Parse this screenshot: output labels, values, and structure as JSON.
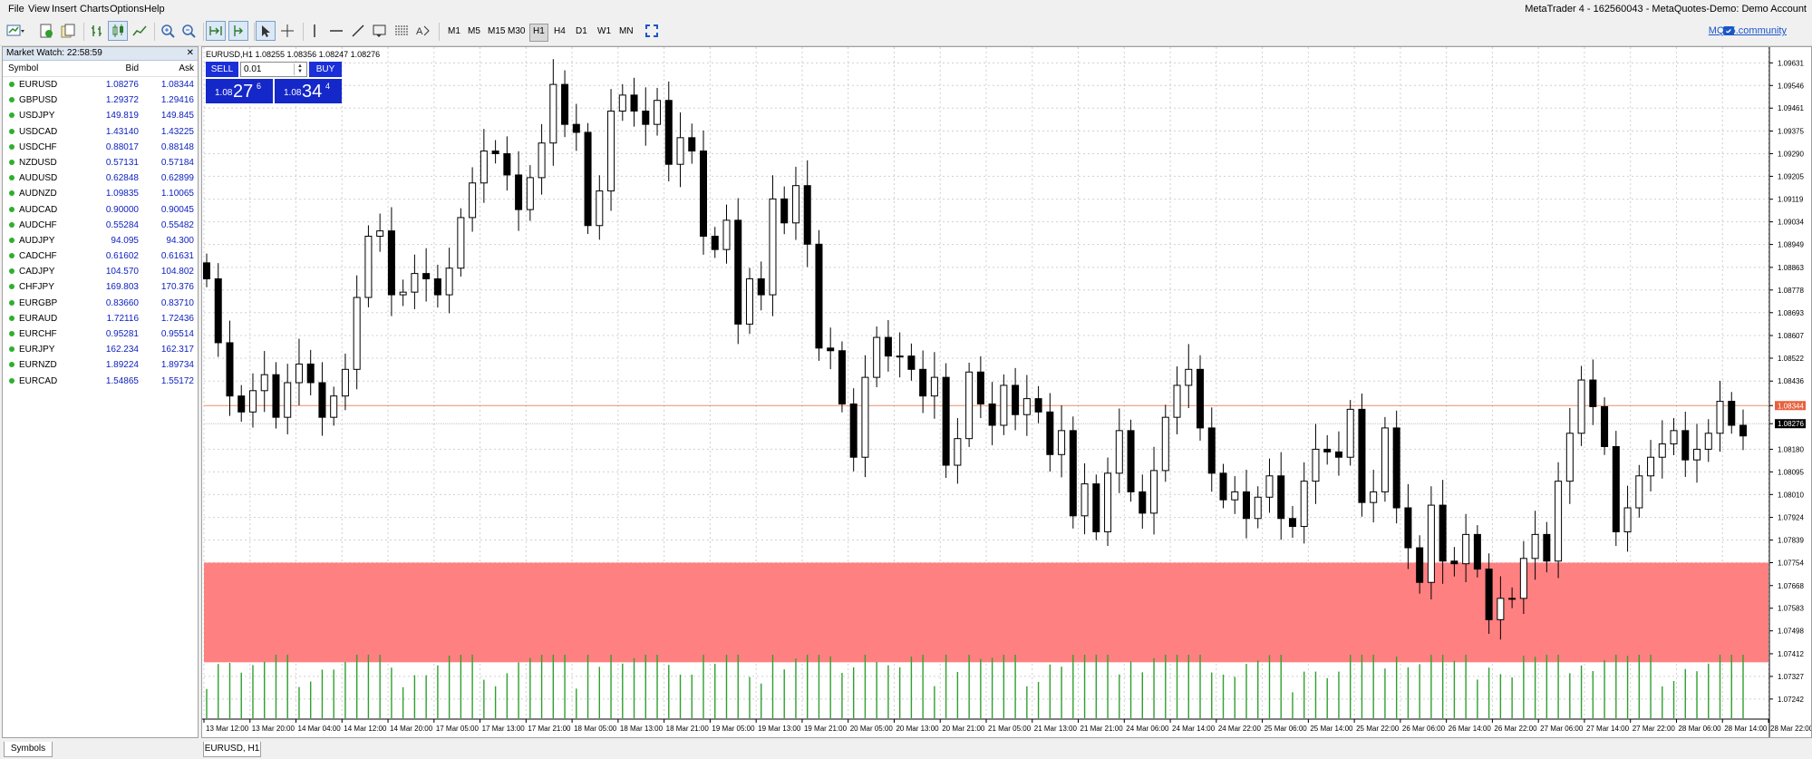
{
  "window": {
    "title": "MetaTrader 4 - 162560043 - MetaQuotes-Demo: Demo Account"
  },
  "menu": {
    "items": [
      "File",
      "View",
      "Insert",
      "Charts",
      "Options",
      "Help"
    ]
  },
  "toolbar": {
    "timeframes": [
      "M1",
      "M5",
      "M15",
      "M30",
      "H1",
      "H4",
      "D1",
      "W1",
      "MN"
    ],
    "active_timeframe": "H1",
    "mql_link": "MQL5.community"
  },
  "market_watch": {
    "title": "Market Watch: 22:58:59",
    "columns": {
      "symbol": "Symbol",
      "bid": "Bid",
      "ask": "Ask"
    },
    "rows": [
      {
        "symbol": "EURUSD",
        "bid": "1.08276",
        "ask": "1.08344"
      },
      {
        "symbol": "GBPUSD",
        "bid": "1.29372",
        "ask": "1.29416"
      },
      {
        "symbol": "USDJPY",
        "bid": "149.819",
        "ask": "149.845"
      },
      {
        "symbol": "USDCAD",
        "bid": "1.43140",
        "ask": "1.43225"
      },
      {
        "symbol": "USDCHF",
        "bid": "0.88017",
        "ask": "0.88148"
      },
      {
        "symbol": "NZDUSD",
        "bid": "0.57131",
        "ask": "0.57184"
      },
      {
        "symbol": "AUDUSD",
        "bid": "0.62848",
        "ask": "0.62899"
      },
      {
        "symbol": "AUDNZD",
        "bid": "1.09835",
        "ask": "1.10065"
      },
      {
        "symbol": "AUDCAD",
        "bid": "0.90000",
        "ask": "0.90045"
      },
      {
        "symbol": "AUDCHF",
        "bid": "0.55284",
        "ask": "0.55482"
      },
      {
        "symbol": "AUDJPY",
        "bid": "94.095",
        "ask": "94.300"
      },
      {
        "symbol": "CADCHF",
        "bid": "0.61602",
        "ask": "0.61631"
      },
      {
        "symbol": "CADJPY",
        "bid": "104.570",
        "ask": "104.802"
      },
      {
        "symbol": "CHFJPY",
        "bid": "169.803",
        "ask": "170.376"
      },
      {
        "symbol": "EURGBP",
        "bid": "0.83660",
        "ask": "0.83710"
      },
      {
        "symbol": "EURAUD",
        "bid": "1.72116",
        "ask": "1.72436"
      },
      {
        "symbol": "EURCHF",
        "bid": "0.95281",
        "ask": "0.95514"
      },
      {
        "symbol": "EURJPY",
        "bid": "162.234",
        "ask": "162.317"
      },
      {
        "symbol": "EURNZD",
        "bid": "1.89224",
        "ask": "1.89734"
      },
      {
        "symbol": "EURCAD",
        "bid": "1.54865",
        "ask": "1.55172"
      }
    ],
    "tab_label": "Symbols"
  },
  "chart": {
    "tab_label": "EURUSD, H1",
    "ohlc_header": "EURUSD,H1  1.08255 1.08356 1.08247 1.08276",
    "trade_panel": {
      "sell_label": "SELL",
      "buy_label": "BUY",
      "lot": "0.01",
      "sell_prefix": "1.08",
      "sell_big": "27",
      "sell_sup": "6",
      "buy_prefix": "1.08",
      "buy_big": "34",
      "buy_sup": "4"
    },
    "colors": {
      "bull": "#ffffff",
      "bear": "#000000",
      "zone": "#ff8080",
      "ask_line": "#e8906a",
      "volume": "#2ea02e"
    }
  },
  "chart_data": {
    "type": "candlestick",
    "symbol": "EURUSD",
    "timeframe": "H1",
    "ylim": [
      1.0717,
      1.0969
    ],
    "price_ticks": [
      "1.09631",
      "1.09546",
      "1.09461",
      "1.09375",
      "1.09290",
      "1.09205",
      "1.09119",
      "1.09034",
      "1.08949",
      "1.08863",
      "1.08778",
      "1.08693",
      "1.08607",
      "1.08522",
      "1.08436",
      "1.08344",
      "1.08276",
      "1.08180",
      "1.08095",
      "1.08010",
      "1.07924",
      "1.07839",
      "1.07754",
      "1.07668",
      "1.07583",
      "1.07498",
      "1.07412",
      "1.07327",
      "1.07242"
    ],
    "time_ticks": [
      "13 Mar 12:00",
      "13 Mar 20:00",
      "14 Mar 04:00",
      "14 Mar 12:00",
      "14 Mar 20:00",
      "17 Mar 05:00",
      "17 Mar 13:00",
      "17 Mar 21:00",
      "18 Mar 05:00",
      "18 Mar 13:00",
      "18 Mar 21:00",
      "19 Mar 05:00",
      "19 Mar 13:00",
      "19 Mar 21:00",
      "20 Mar 05:00",
      "20 Mar 13:00",
      "20 Mar 21:00",
      "21 Mar 05:00",
      "21 Mar 13:00",
      "21 Mar 21:00",
      "24 Mar 06:00",
      "24 Mar 14:00",
      "24 Mar 22:00",
      "25 Mar 06:00",
      "25 Mar 14:00",
      "25 Mar 22:00",
      "26 Mar 06:00",
      "26 Mar 14:00",
      "26 Mar 22:00",
      "27 Mar 06:00",
      "27 Mar 14:00",
      "27 Mar 22:00",
      "28 Mar 06:00",
      "28 Mar 14:00",
      "28 Mar 22:00"
    ],
    "bid_line": 1.08276,
    "ask_line": 1.08344,
    "zone": {
      "high": 1.07754,
      "low": 1.0738
    },
    "closes": [
      1.0882,
      1.0858,
      1.0838,
      1.0832,
      1.084,
      1.0846,
      1.083,
      1.0843,
      1.085,
      1.0843,
      1.083,
      1.0838,
      1.0848,
      1.0875,
      1.0898,
      1.09,
      1.0876,
      1.0877,
      1.0884,
      1.0882,
      1.0876,
      1.0886,
      1.0905,
      1.0918,
      1.093,
      1.0929,
      1.0921,
      1.0908,
      1.092,
      1.0933,
      1.0955,
      1.094,
      1.0937,
      1.0902,
      1.0915,
      1.0945,
      1.0951,
      1.0945,
      1.094,
      1.0949,
      1.0925,
      1.0935,
      1.093,
      1.0898,
      1.0893,
      1.0904,
      1.0865,
      1.0882,
      1.0876,
      1.0912,
      1.0903,
      1.0917,
      1.0895,
      1.0856,
      1.0855,
      1.0835,
      1.0815,
      1.0845,
      1.086,
      1.0853,
      1.0853,
      1.0848,
      1.0838,
      1.0845,
      1.0812,
      1.0822,
      1.0847,
      1.0835,
      1.0827,
      1.0842,
      1.0831,
      1.0837,
      1.0832,
      1.0816,
      1.0825,
      1.0793,
      1.0805,
      1.0787,
      1.0809,
      1.0825,
      1.0802,
      1.0794,
      1.081,
      1.083,
      1.0842,
      1.0848,
      1.0826,
      1.0809,
      1.0799,
      1.0802,
      1.0792,
      1.08,
      1.0808,
      1.0792,
      1.0789,
      1.0806,
      1.0818,
      1.0817,
      1.0815,
      1.0833,
      1.0798,
      1.0802,
      1.0826,
      1.0796,
      1.0781,
      1.0768,
      1.0797,
      1.0776,
      1.0775,
      1.0786,
      1.0773,
      1.0754,
      1.0762,
      1.0762,
      1.0777,
      1.0786,
      1.0776,
      1.0806,
      1.0824,
      1.0844,
      1.0834,
      1.0819,
      1.0787,
      1.0796,
      1.0808,
      1.0815,
      1.082,
      1.0825,
      1.0814,
      1.0818,
      1.0824,
      1.0836,
      1.0827,
      1.0823
    ]
  }
}
